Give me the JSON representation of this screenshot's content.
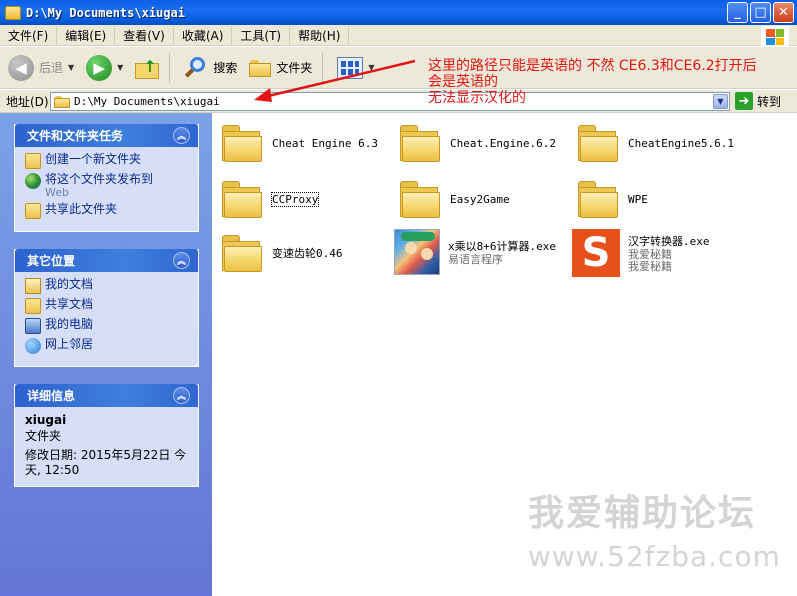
{
  "window": {
    "title": "D:\\My Documents\\xiugai",
    "minimize": "_",
    "maximize": "□",
    "close": "✕"
  },
  "menu": [
    "文件(F)",
    "编辑(E)",
    "查看(V)",
    "收藏(A)",
    "工具(T)",
    "帮助(H)"
  ],
  "toolbar": {
    "back_label": "后退",
    "search_label": "搜索",
    "folders_label": "文件夹"
  },
  "address": {
    "label": "地址(D)",
    "value": "D:\\My Documents\\xiugai",
    "go_label": "转到"
  },
  "annotation": {
    "line1": "这里的路径只能是英语的 不然 CE6.3和CE6.2打开后",
    "line2": "会是英语的",
    "line3": "无法显示汉化的",
    "color": "#e01414"
  },
  "tasks_panel": {
    "title": "文件和文件夹任务",
    "items": [
      {
        "label": "创建一个新文件夹",
        "icon": "new-folder-icon"
      },
      {
        "label": "将这个文件夹发布到",
        "sub": "Web",
        "icon": "publish-web-icon"
      },
      {
        "label": "共享此文件夹",
        "icon": "share-folder-icon"
      }
    ]
  },
  "places_panel": {
    "title": "其它位置",
    "items": [
      {
        "label": "我的文档",
        "icon": "my-documents-icon"
      },
      {
        "label": "共享文档",
        "icon": "shared-documents-icon"
      },
      {
        "label": "我的电脑",
        "icon": "my-computer-icon"
      },
      {
        "label": "网上邻居",
        "icon": "network-places-icon"
      }
    ]
  },
  "details_panel": {
    "title": "详细信息",
    "name": "xiugai",
    "type": "文件夹",
    "modified_label": "修改日期:",
    "modified_value": "2015年5月22日 今天, 12:50"
  },
  "files": [
    {
      "name": "Cheat Engine 6.3",
      "kind": "folder"
    },
    {
      "name": "Cheat.Engine.6.2",
      "kind": "folder"
    },
    {
      "name": "CheatEngine5.6.1",
      "kind": "folder"
    },
    {
      "name": "CCProxy",
      "kind": "folder",
      "selected": true
    },
    {
      "name": "Easy2Game",
      "kind": "folder"
    },
    {
      "name": "WPE",
      "kind": "folder"
    },
    {
      "name": "变速齿轮0.46",
      "kind": "folder"
    },
    {
      "name": "x乘以8+6计算器.exe",
      "sub": "易语言程序",
      "kind": "exe"
    },
    {
      "name": "汉字转换器.exe",
      "sub": "我爱秘籍",
      "sub2": "我爱秘籍",
      "kind": "exe"
    }
  ],
  "watermark": {
    "line1": "我爱辅助论坛",
    "line2": "www.52fzba.com"
  }
}
